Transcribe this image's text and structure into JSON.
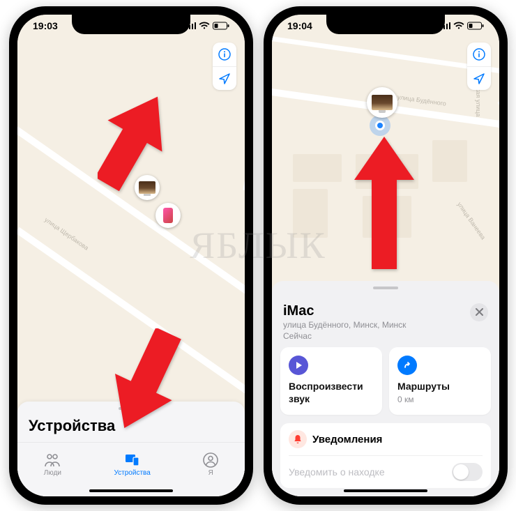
{
  "watermark": "ЯБЛЫК",
  "left": {
    "time": "19:03",
    "sheet_title": "Устройства",
    "tabs": [
      {
        "label": "Люди",
        "name": "tab-people"
      },
      {
        "label": "Устройства",
        "name": "tab-devices"
      },
      {
        "label": "Я",
        "name": "tab-me"
      }
    ],
    "roads": [
      "улица Щербакова"
    ]
  },
  "right": {
    "time": "19:04",
    "roads": [
      "улица Будённого",
      "улица Ванеева",
      "Сталинская улица"
    ],
    "device": {
      "name": "iMac",
      "address": "улица Будённого, Минск, Минск",
      "timestamp": "Сейчас"
    },
    "actions": {
      "play_sound": "Воспроизвести звук",
      "directions_label": "Маршруты",
      "directions_distance": "0 км"
    },
    "notifications": {
      "title": "Уведомления",
      "notify_found": "Уведомить о находке"
    }
  }
}
